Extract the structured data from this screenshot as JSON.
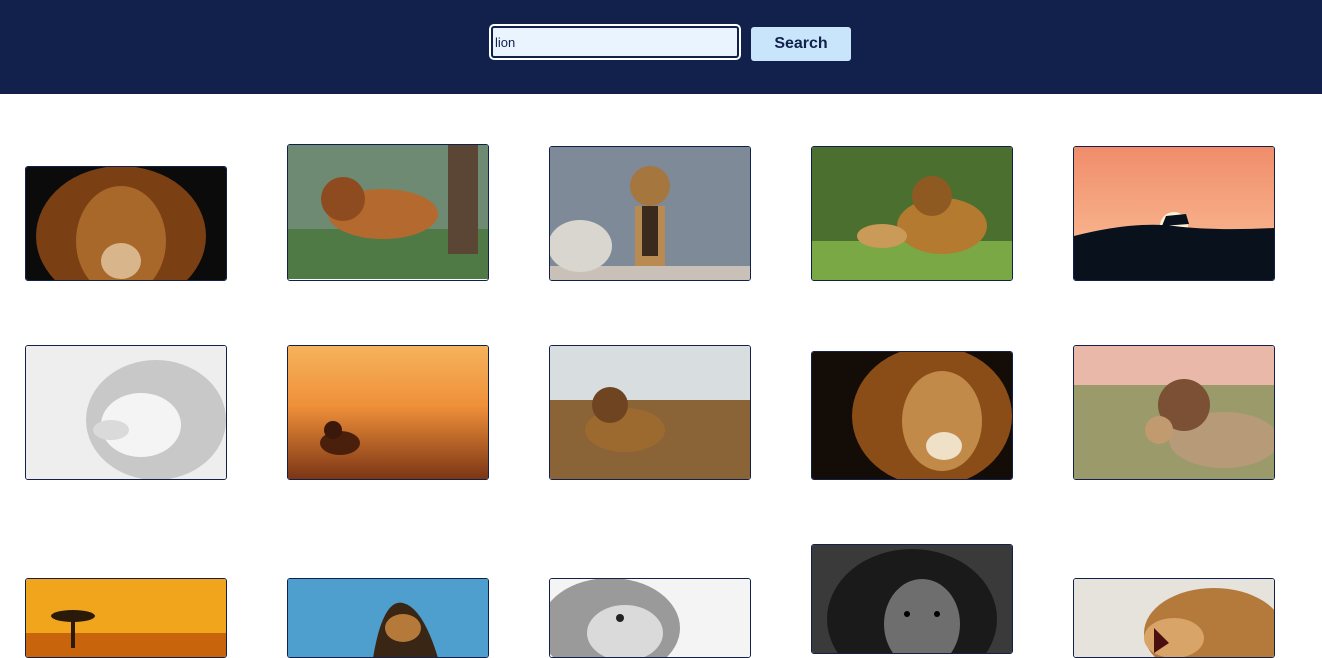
{
  "search": {
    "value": "lion",
    "button_label": "Search"
  },
  "results": [
    {
      "name": "image-lion-closeup-dark-mane"
    },
    {
      "name": "image-lion-walking-forest"
    },
    {
      "name": "image-lion-standing-rock-enclosure"
    },
    {
      "name": "image-lion-and-cub-on-grass"
    },
    {
      "name": "image-lion-silhouette-sunset"
    },
    {
      "name": "image-white-lion-profile"
    },
    {
      "name": "image-lion-lying-golden-savanna"
    },
    {
      "name": "image-lion-lying-dry-grass"
    },
    {
      "name": "image-lion-face-golden-mane"
    },
    {
      "name": "image-lion-with-cub-pink-sky"
    },
    {
      "name": "image-acacia-tree-orange-sunset"
    },
    {
      "name": "image-lion-blue-sky"
    },
    {
      "name": "image-lion-black-and-white-closeup"
    },
    {
      "name": "image-lion-dark-monochrome"
    },
    {
      "name": "image-lion-roaring"
    }
  ]
}
